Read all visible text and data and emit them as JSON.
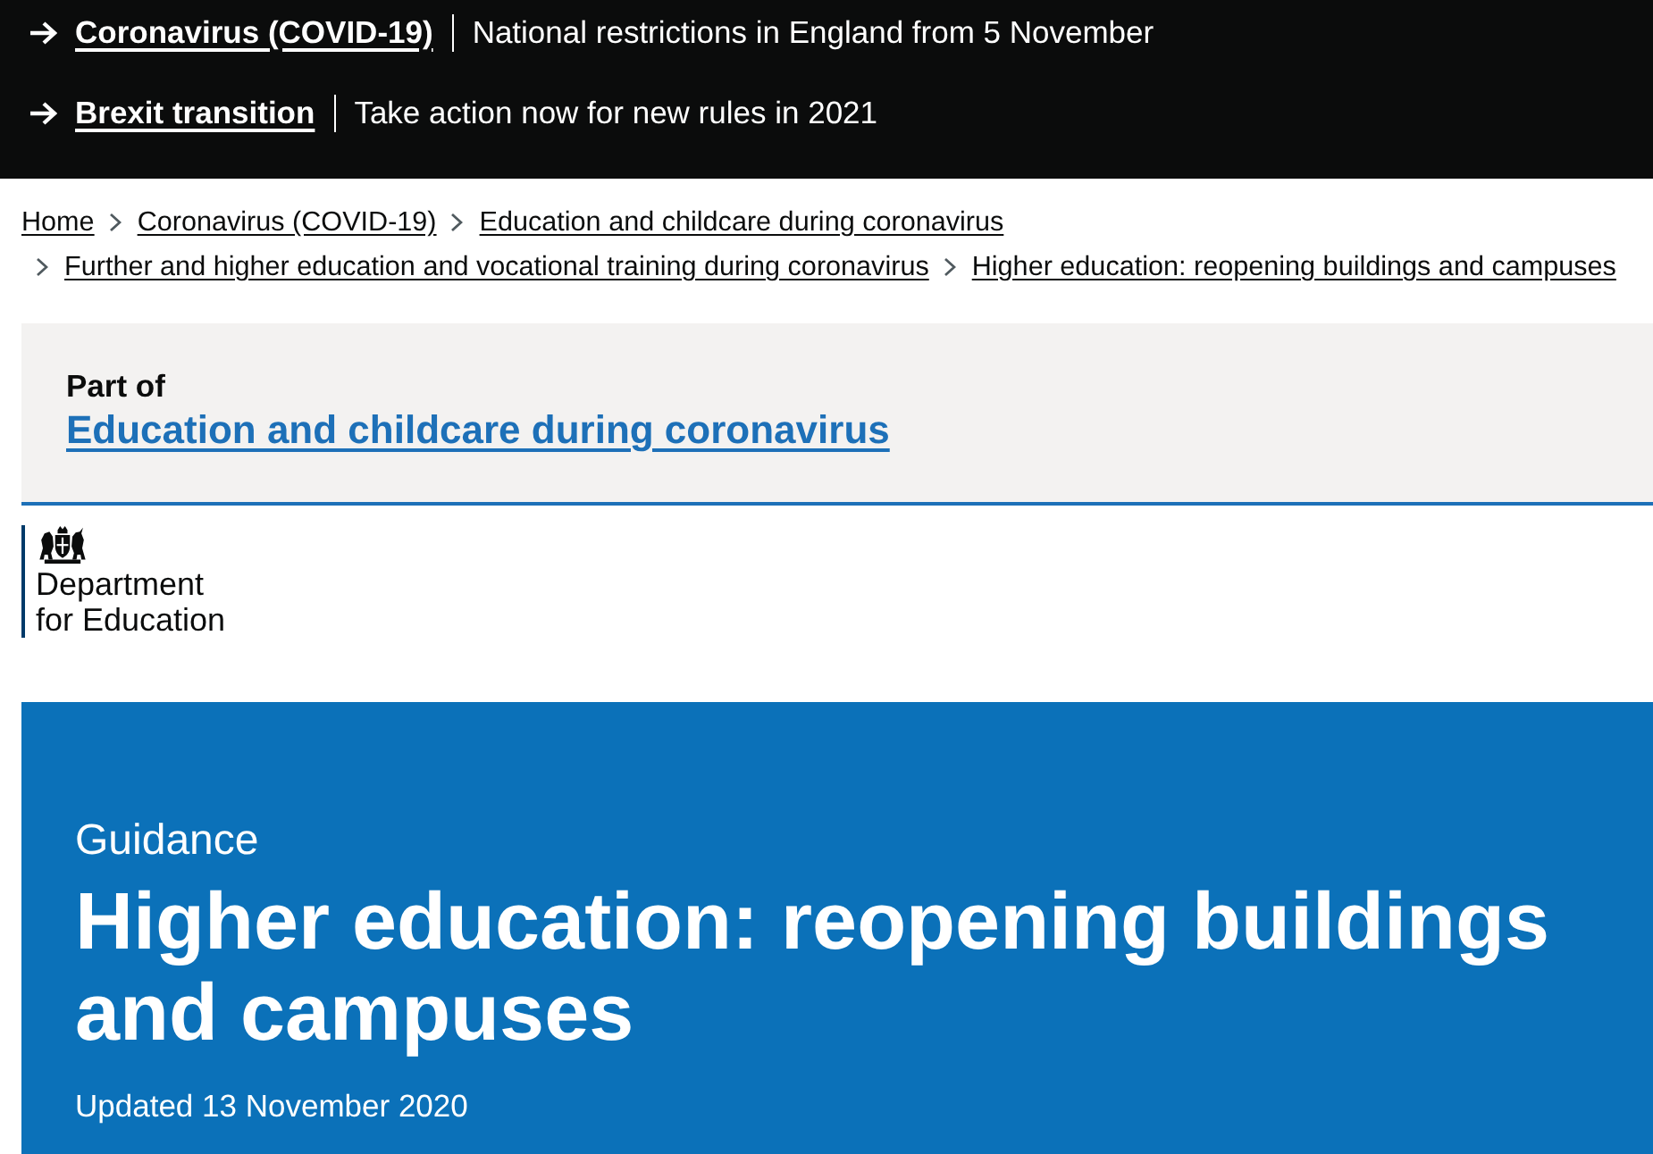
{
  "notification_banners": [
    {
      "link": "Coronavirus (COVID-19)",
      "text": "National restrictions in England from 5 November"
    },
    {
      "link": "Brexit transition",
      "text": "Take action now for new rules in 2021"
    }
  ],
  "breadcrumbs": [
    "Home",
    "Coronavirus (COVID-19)",
    "Education and childcare during coronavirus",
    "Further and higher education and vocational training during coronavirus",
    "Higher education: reopening buildings and campuses"
  ],
  "part_of": {
    "label": "Part of",
    "link": "Education and childcare during coronavirus"
  },
  "organisation": {
    "name": "Department for Education"
  },
  "header": {
    "document_type": "Guidance",
    "title": "Higher education: reopening buildings and campuses",
    "updated": "Updated 13 November 2020"
  }
}
